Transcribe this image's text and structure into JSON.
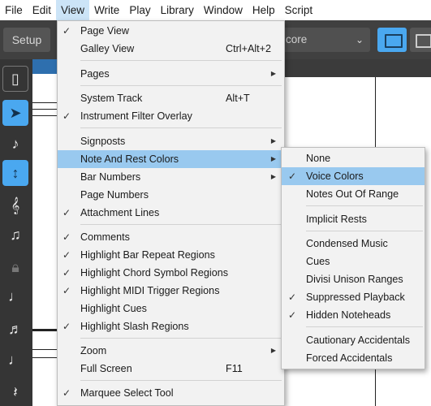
{
  "menubar": {
    "items": [
      "File",
      "Edit",
      "View",
      "Write",
      "Play",
      "Library",
      "Window",
      "Help",
      "Script"
    ],
    "active": "View"
  },
  "toolbar": {
    "setup_label": "Setup",
    "mode_label": "core"
  },
  "view_menu": {
    "items": [
      {
        "label": "Page View",
        "checked": true
      },
      {
        "label": "Galley View",
        "shortcut": "Ctrl+Alt+2"
      },
      {
        "label": "Pages",
        "submenu": true
      },
      {
        "label": "System Track",
        "shortcut": "Alt+T"
      },
      {
        "label": "Instrument Filter Overlay",
        "checked": true
      },
      {
        "label": "Signposts",
        "submenu": true
      },
      {
        "label": "Note And Rest Colors",
        "submenu": true,
        "highlighted": true
      },
      {
        "label": "Bar Numbers",
        "submenu": true
      },
      {
        "label": "Page Numbers"
      },
      {
        "label": "Attachment Lines",
        "checked": true
      },
      {
        "label": "Comments",
        "checked": true
      },
      {
        "label": "Highlight Bar Repeat Regions",
        "checked": true
      },
      {
        "label": "Highlight Chord Symbol Regions",
        "checked": true
      },
      {
        "label": "Highlight MIDI Trigger Regions",
        "checked": true
      },
      {
        "label": "Highlight Cues"
      },
      {
        "label": "Highlight Slash Regions",
        "checked": true
      },
      {
        "label": "Zoom",
        "submenu": true
      },
      {
        "label": "Full Screen",
        "shortcut": "F11"
      },
      {
        "label": "Marquee Select Tool",
        "checked": true
      }
    ]
  },
  "sub_menu": {
    "items": [
      {
        "label": "None"
      },
      {
        "label": "Voice Colors",
        "checked": true,
        "highlighted": true
      },
      {
        "label": "Notes Out Of Range"
      },
      {
        "label": "Implicit Rests"
      },
      {
        "label": "Condensed Music"
      },
      {
        "label": "Cues"
      },
      {
        "label": "Divisi Unison Ranges"
      },
      {
        "label": "Suppressed Playback",
        "checked": true
      },
      {
        "label": "Hidden Noteheads",
        "checked": true
      },
      {
        "label": "Cautionary Accidentals"
      },
      {
        "label": "Forced Accidentals"
      }
    ]
  },
  "glyphs": {
    "check": "✓",
    "submenu_arrow": "▶",
    "chevron": "⌄"
  },
  "colors": {
    "highlight": "#99c9ef",
    "accent": "#4aa8f0"
  }
}
